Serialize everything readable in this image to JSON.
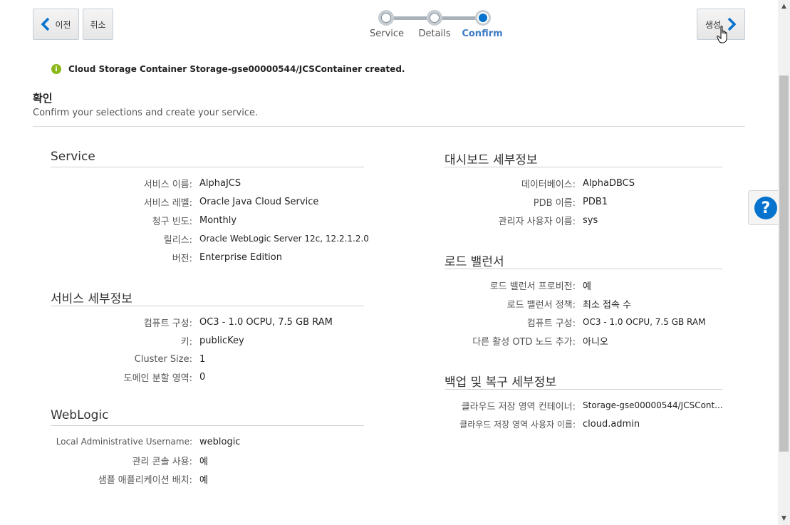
{
  "toolbar": {
    "prev_label": "이전",
    "cancel_label": "취소",
    "create_label": "생성"
  },
  "train": {
    "stops": [
      {
        "label": "Service",
        "state": "visited"
      },
      {
        "label": "Details",
        "state": "visited"
      },
      {
        "label": "Confirm",
        "state": "current"
      }
    ]
  },
  "message": {
    "icon": "info-icon",
    "text": "Cloud Storage Container Storage-gse00000544/JCSContainer created."
  },
  "page": {
    "title": "확인",
    "subtitle": "Confirm your selections and create your service."
  },
  "left": {
    "service": {
      "title": "Service",
      "rows": [
        {
          "label": "서비스 이름:",
          "value": "AlphaJCS"
        },
        {
          "label": "서비스 레벨:",
          "value": "Oracle Java Cloud Service"
        },
        {
          "label": "청구 빈도:",
          "value": "Monthly"
        },
        {
          "label": "릴리스:",
          "value": "Oracle WebLogic Server 12c, 12.2.1.2.0"
        },
        {
          "label": "버전:",
          "value": "Enterprise Edition"
        }
      ]
    },
    "details": {
      "title": "서비스 세부정보",
      "rows": [
        {
          "label": "컴퓨트 구성:",
          "value": "OC3 - 1.0 OCPU, 7.5 GB RAM"
        },
        {
          "label": "키:",
          "value": "publicKey"
        },
        {
          "label": "Cluster Size:",
          "value": "1"
        },
        {
          "label": "도메인 분할 영역:",
          "value": "0"
        }
      ]
    },
    "weblogic": {
      "title": "WebLogic",
      "rows": [
        {
          "label": "Local Administrative Username:",
          "value": "weblogic"
        },
        {
          "label": "관리 콘솔 사용:",
          "value": "예"
        },
        {
          "label": "샘플 애플리케이션 배치:",
          "value": "예"
        }
      ]
    }
  },
  "right": {
    "dashboard": {
      "title": "대시보드 세부정보",
      "rows": [
        {
          "label": "데이터베이스:",
          "value": "AlphaDBCS"
        },
        {
          "label": "PDB 이름:",
          "value": "PDB1"
        },
        {
          "label": "관리자 사용자 이름:",
          "value": "sys"
        }
      ]
    },
    "lb": {
      "title": "로드 밸런서",
      "rows": [
        {
          "label": "로드 밸런서 프로비전:",
          "value": "예"
        },
        {
          "label": "로드 밸런서 정책:",
          "value": "최소 접속 수"
        },
        {
          "label": "컴퓨트 구성:",
          "value": "OC3 - 1.0 OCPU, 7.5 GB RAM"
        },
        {
          "label": "다른 활성 OTD 노드 추가:",
          "value": "아니오"
        }
      ]
    },
    "backup": {
      "title": "백업 및 복구 세부정보",
      "rows": [
        {
          "label": "클라우드 저장 영역 컨테이너:",
          "value": "Storage-gse00000544/JCSCont..."
        },
        {
          "label": "클라우드 저장 영역 사용자 이름:",
          "value": "cloud.admin"
        }
      ]
    }
  },
  "help": {
    "label": "?"
  },
  "colors": {
    "accent": "#0572ce",
    "info": "#8ab71a",
    "active_step": "#3e7bc4"
  }
}
